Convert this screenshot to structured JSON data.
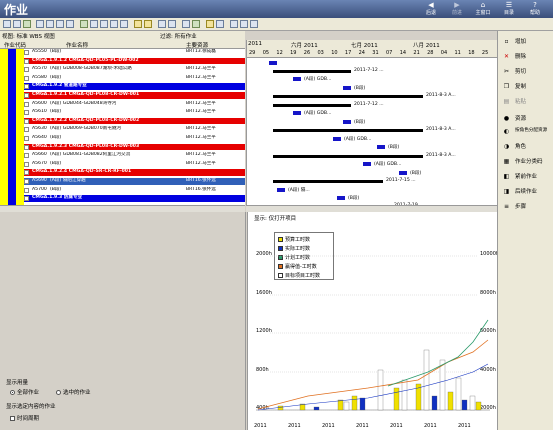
{
  "app": {
    "title": "作业"
  },
  "nav": {
    "back": "后退",
    "forward": "前进",
    "home": "主窗口",
    "dir": "目录",
    "help": "帮助"
  },
  "grid": {
    "view_label": "视图: 标准 WBS 视图",
    "filter_label": "过滤: 所有作业",
    "col_code": "作业代码",
    "col_name": "作业名称",
    "col_res": "主要资源",
    "rows": [
      {
        "type": "act",
        "code": "A5550",
        "name": "(B段)",
        "res": "BRT13.徐成磊"
      },
      {
        "type": "red",
        "code": "",
        "name": "CMGA.1.9.1.2  CMGA-QD-PL05-PL-DW-002",
        "res": ""
      },
      {
        "type": "act",
        "code": "A5570",
        "name": "(A段) GDB008-GDB087湖坝-禾础公路",
        "res": "BRT12.马兰平"
      },
      {
        "type": "act",
        "code": "A5580",
        "name": "(B段)",
        "res": "BRT12.马兰平"
      },
      {
        "type": "blue",
        "code": "",
        "name": "CMGA.1.9.2  管道路专业",
        "res": ""
      },
      {
        "type": "red",
        "code": "",
        "name": "CMGA.1.9.2.1  CMGA-QD-PL08-CR-DW-001",
        "res": ""
      },
      {
        "type": "act",
        "code": "A5600",
        "name": "(A段) GDB044-GDB048湾寺河",
        "res": "BRT12.马兰平"
      },
      {
        "type": "act",
        "code": "A5610",
        "name": "(B段)",
        "res": "BRT12.马兰平"
      },
      {
        "type": "red",
        "code": "",
        "name": "CMGA.1.9.2.2  CMGA-QD-PL08-CR-DW-002",
        "res": ""
      },
      {
        "type": "act",
        "code": "A5630",
        "name": "(A段) GDB069-GDB070南屯隧河",
        "res": "BRT12.马兰平"
      },
      {
        "type": "act",
        "code": "A5640",
        "name": "(B段)",
        "res": "BRT12.马兰平"
      },
      {
        "type": "red",
        "code": "",
        "name": "CMGA.1.9.2.3  CMGA-QD-PL08-CR-DW-003",
        "res": ""
      },
      {
        "type": "act",
        "code": "A5660",
        "name": "(A段) GDB081-GDB082阿里江河交流",
        "res": "BRT12.马兰平"
      },
      {
        "type": "act",
        "code": "A5670",
        "name": "(B段)",
        "res": "BRT12.马兰平"
      },
      {
        "type": "red",
        "code": "",
        "name": "CMGA.1.9.2.4  CMGA-QD-SR-CR-RF-001",
        "res": ""
      },
      {
        "type": "sel",
        "code": "A5690",
        "name": "(A段) 隔陌江穿越",
        "res": "BRT16.张怀远"
      },
      {
        "type": "act",
        "code": "A5700",
        "name": "(B段)",
        "res": "BRT16.张怀远"
      },
      {
        "type": "blue",
        "code": "",
        "name": "CMGA.1.9.3  防腐专业",
        "res": ""
      }
    ]
  },
  "gantt": {
    "year": "2011",
    "months": [
      "六月 2011",
      "七月 2011",
      "八月 2011"
    ],
    "days": [
      "29",
      "05",
      "12",
      "19",
      "26",
      "03",
      "10",
      "17",
      "24",
      "31",
      "07",
      "14",
      "21",
      "28",
      "04",
      "11",
      "18",
      "25"
    ],
    "bar_labels": [
      "2011-7-12 ...",
      "(A段) GDB...",
      "(B段)",
      "2011-8-3 A...",
      "2011-7-12 ...",
      "(A段) GDB...",
      "(B段)",
      "2011-8-3 A...",
      "(A段) GDB...",
      "(B段)",
      "2011-8-3 A...",
      "(A段) GDB...",
      "(B段)",
      "2011-7-15 ...",
      "(A段) 隔...",
      "(B段)",
      "2011-7-19 ..."
    ]
  },
  "histogram": {
    "header": "显示: 仅打开项目",
    "legend": [
      {
        "label": "预算工时数",
        "color": "#f0e000"
      },
      {
        "label": "实际工时数",
        "color": "#1030c0"
      },
      {
        "label": "计划工时数",
        "color": "#2a9a6a"
      },
      {
        "label": "赢得值-工时数",
        "color": "#e07020"
      },
      {
        "label": "目标项目工时数",
        "color": "#ffffff"
      }
    ],
    "left_ticks": [
      "2000h",
      "1600h",
      "1200h",
      "800h",
      "400h"
    ],
    "right_ticks": [
      "10000h",
      "8000h",
      "6000h",
      "4000h",
      "2000h"
    ],
    "x_labels": [
      "2011",
      "2011",
      "2011",
      "2011",
      "2011",
      "2011",
      "2011"
    ]
  },
  "lower_left": {
    "display_usage": "显示用量",
    "all_activities": "全部作业",
    "selected_activities": "选中的作业",
    "show_selected": "显示选定内容的作业",
    "time_period": "时间周期"
  },
  "right_buttons": {
    "add": "增加",
    "delete": "删除",
    "cut": "剪切",
    "copy": "复制",
    "paste": "粘贴",
    "resources": "资源",
    "assign_role": "按角色分配资源",
    "roles": "角色",
    "activity_code": "作业分类码",
    "predecessors": "紧前作业",
    "successors": "后续作业",
    "steps": "步骤"
  }
}
